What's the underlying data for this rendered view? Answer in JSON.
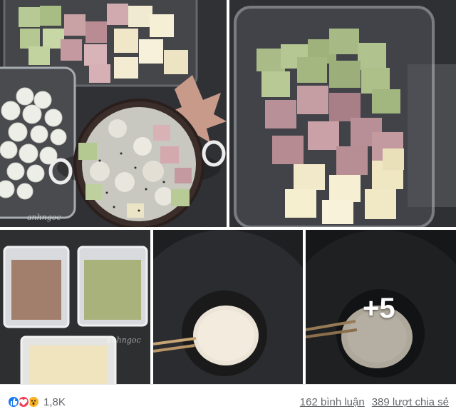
{
  "post": {
    "photos": [
      {
        "id": "photo-1",
        "watermark": "anhngoc"
      },
      {
        "id": "photo-2"
      },
      {
        "id": "photo-3",
        "watermark": "anhngoc"
      },
      {
        "id": "photo-4"
      },
      {
        "id": "photo-5",
        "more_label": "+5"
      }
    ]
  },
  "footer": {
    "reactions": {
      "icons": [
        "like-icon",
        "love-icon",
        "wow-icon"
      ],
      "count": "1,8K"
    },
    "comments": "162 bình luận",
    "shares": "389 lượt chia sẻ"
  },
  "colors": {
    "like": "#1877f2",
    "love": "#f33e58",
    "wow": "#f7b125",
    "text_secondary": "#65676b"
  }
}
